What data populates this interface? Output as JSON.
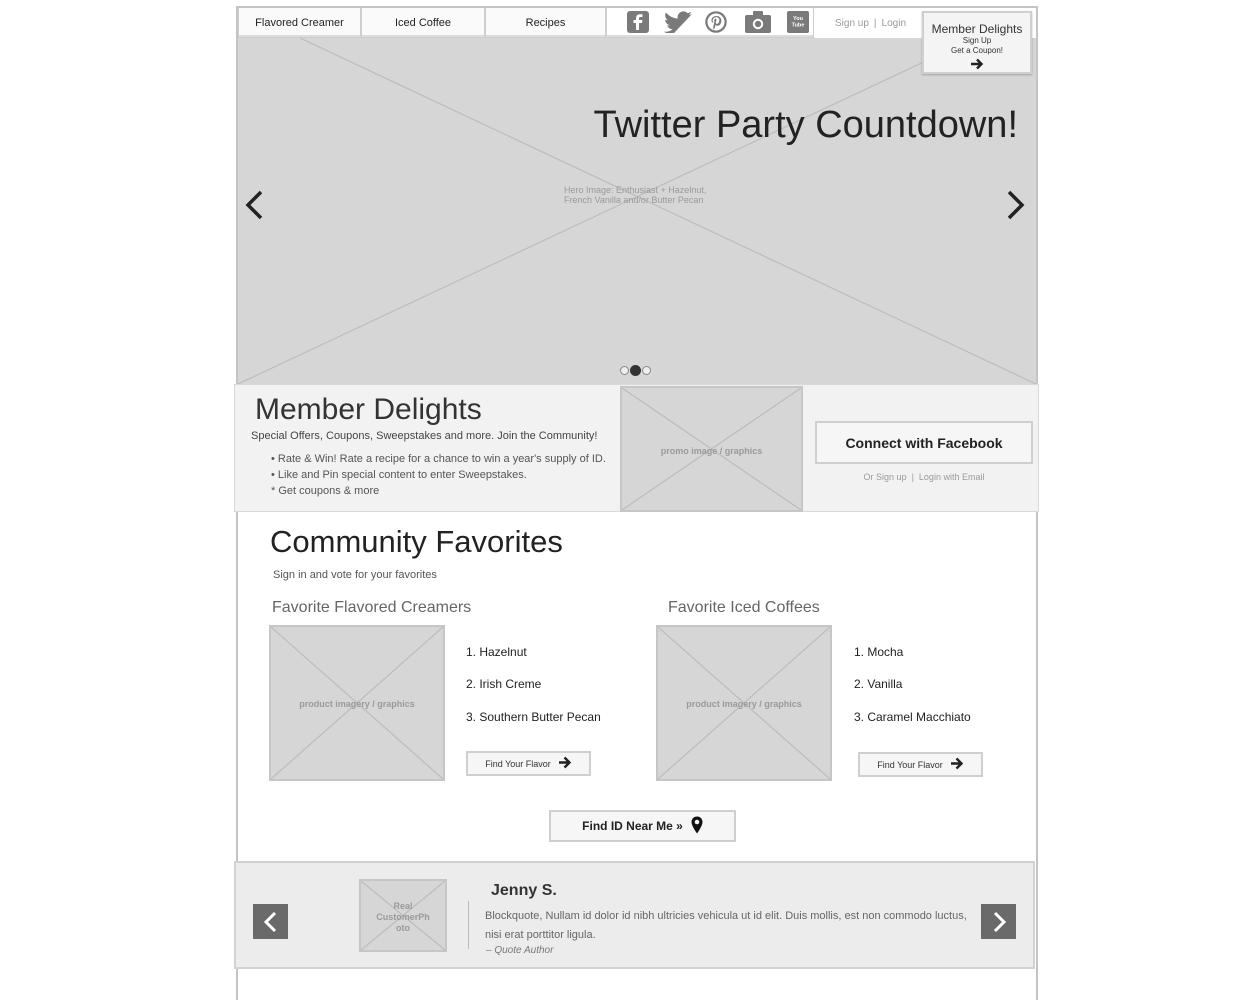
{
  "nav": {
    "tabs": [
      {
        "label": "Flavored Creamer"
      },
      {
        "label": "Iced Coffee"
      },
      {
        "label": "Recipes"
      }
    ],
    "social_icons": [
      "facebook-icon",
      "twitter-icon",
      "pinterest-icon",
      "instagram-icon",
      "youtube-icon"
    ],
    "youtube_text": "You Tube",
    "signup_label": "Sign up",
    "separator": "|",
    "login_label": "Login"
  },
  "member_box": {
    "title": "Member Delights",
    "line1": "Sign Up",
    "line2": "Get a Coupon!"
  },
  "hero": {
    "title": "Twitter Party Countdown!",
    "placeholder_note": "Hero Image: Enthusiast + Hazelnut, French Vanilla and/or Butter Pecan",
    "slide_count": 3,
    "active_slide": 2
  },
  "member_delights": {
    "title": "Member Delights",
    "subtitle": "Special Offers, Coupons, Sweepstakes and more. Join the Community!",
    "bullets": [
      "• Rate & Win! Rate a recipe for a chance to win a year's supply of ID.",
      "• Like and Pin special content to enter Sweepstakes.",
      "* Get coupons & more"
    ],
    "promo_label": "promo image / graphics",
    "facebook_button": "Connect with Facebook",
    "or_signup": "Or Sign up",
    "separator": "|",
    "login_email": "Login with Email"
  },
  "community": {
    "title": "Community Favorites",
    "subtitle": "Sign in and vote for your favorites",
    "creamers": {
      "heading": "Favorite Flavored Creamers",
      "image_label": "product imagery / graphics",
      "items": [
        "1. Hazelnut",
        "2. Irish Creme",
        "3. Southern Butter Pecan"
      ],
      "button": "Find Your Flavor"
    },
    "iced": {
      "heading": "Favorite Iced Coffees",
      "image_label": "product imagery / graphics",
      "items": [
        "1. Mocha",
        "2. Vanilla",
        "3. Caramel Macchiato"
      ],
      "button": "Find Your Flavor"
    },
    "near_button": "Find ID Near Me »"
  },
  "testimonial": {
    "photo_label": "Real CustomerPh oto",
    "name": "Jenny S.",
    "quote": "Blockquote, Nullam id dolor id nibh ultricies vehicula ut id elit. Duis mollis, est non commodo luctus, nisi erat porttitor ligula.",
    "author": "– Quote Author"
  }
}
